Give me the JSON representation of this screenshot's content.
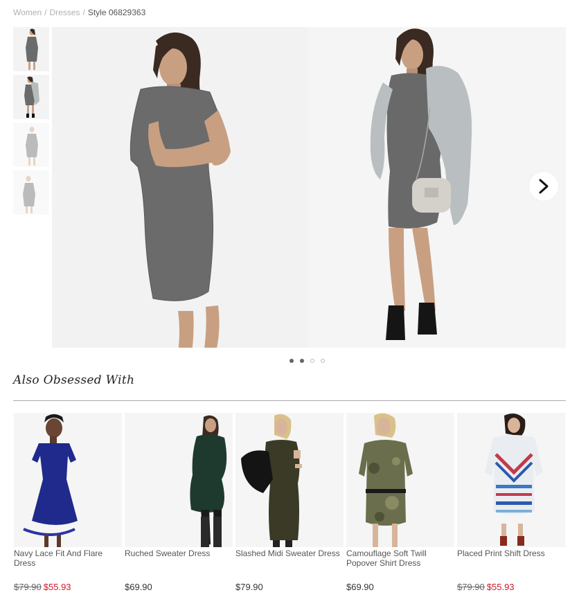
{
  "breadcrumb": {
    "items": [
      "Women",
      "Dresses"
    ],
    "separator": "/",
    "current": "Style 06829363"
  },
  "thumbnails": [
    {
      "icon": "dress-photo-thumbnail",
      "state": "normal"
    },
    {
      "icon": "dress-photo-thumbnail",
      "state": "normal"
    },
    {
      "icon": "dress-photo-thumbnail",
      "state": "faded"
    },
    {
      "icon": "dress-photo-thumbnail",
      "state": "faded"
    }
  ],
  "gallery": {
    "next_icon": "chevron-right-icon",
    "dots": [
      true,
      true,
      false,
      false
    ]
  },
  "section": {
    "title": "Also Obsessed With"
  },
  "products": [
    {
      "name": "Navy Lace Fit And Flare Dress",
      "old_price": "$79.90",
      "sale_price": "$55.93",
      "price": ""
    },
    {
      "name": "Ruched Sweater Dress",
      "old_price": "",
      "sale_price": "",
      "price": "$69.90"
    },
    {
      "name": "Slashed Midi Sweater Dress",
      "old_price": "",
      "sale_price": "",
      "price": "$79.90"
    },
    {
      "name": "Camouflage Soft Twill Popover Shirt Dress",
      "old_price": "",
      "sale_price": "",
      "price": "$69.90"
    },
    {
      "name": "Placed Print Shift Dress",
      "old_price": "$79.90",
      "sale_price": "$55.93",
      "price": ""
    }
  ],
  "colors": {
    "sale": "#d0192a",
    "dress_gray": "#6b6b6b",
    "navy": "#1f2a8c",
    "forest": "#1e3a2e",
    "olive": "#3b3a26",
    "camo": "#6b6e4c"
  }
}
